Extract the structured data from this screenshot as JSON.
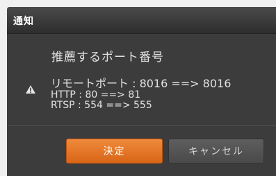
{
  "dialog": {
    "title": "通知",
    "heading": "推薦するポート番号",
    "icon": "warning-icon",
    "lines": [
      "リモートポート : 8016 ==> 8016",
      "HTTP : 80 ==> 81",
      "RTSP : 554 ==> 555"
    ]
  },
  "buttons": {
    "ok_label": "決定",
    "cancel_label": "キャンセル"
  },
  "colors": {
    "accent": "#e0712a",
    "background": "#3c3c3c"
  }
}
